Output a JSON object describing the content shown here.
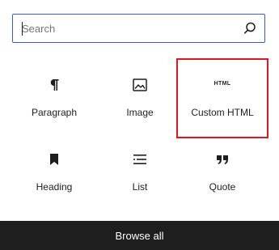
{
  "search": {
    "placeholder": "Search",
    "value": ""
  },
  "blocks": [
    {
      "label": "Paragraph",
      "icon": "paragraph-icon"
    },
    {
      "label": "Image",
      "icon": "image-icon"
    },
    {
      "label": "Custom HTML",
      "icon": "html-icon",
      "icon_text": "HTML",
      "highlighted": true
    },
    {
      "label": "Heading",
      "icon": "heading-icon"
    },
    {
      "label": "List",
      "icon": "list-icon"
    },
    {
      "label": "Quote",
      "icon": "quote-icon"
    }
  ],
  "footer": {
    "browse_all_label": "Browse all"
  },
  "colors": {
    "focus_border": "#3858e9",
    "highlight": "#e0171d",
    "footer_bg": "#1e1e1e"
  }
}
